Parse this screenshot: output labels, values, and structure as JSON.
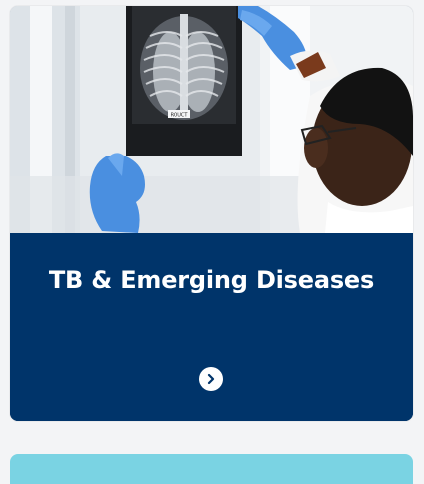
{
  "card": {
    "title": "TB & Emerging Diseases",
    "image_alt": "Doctor examining a chest x-ray",
    "xray_label": "R0UCT",
    "arrow_icon": "chevron-right-icon"
  },
  "colors": {
    "card_background": "#00346a",
    "title_text": "#ffffff",
    "next_card_accent": "#7ad3e3",
    "page_background": "#f3f4f6"
  }
}
